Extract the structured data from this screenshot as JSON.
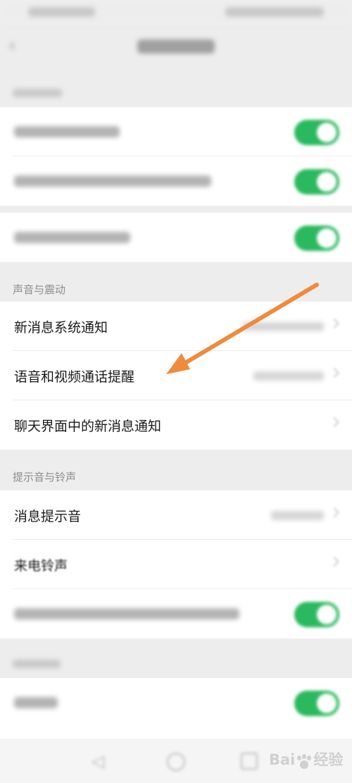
{
  "header": {
    "back_icon": "chevron-left-icon",
    "title_text": ""
  },
  "sections": {
    "sound_vibration": {
      "title": "声音与震动",
      "items": [
        {
          "label": "新消息系统通知",
          "value": ""
        },
        {
          "label": "语音和视频通话提醒",
          "value": ""
        },
        {
          "label": "聊天界面中的新消息通知",
          "value": ""
        }
      ]
    },
    "tones_ringtones": {
      "title": "提示音与铃声",
      "items": [
        {
          "label": "消息提示音",
          "value": ""
        },
        {
          "label": "来电铃声",
          "value": ""
        }
      ]
    }
  },
  "toggle_states": {
    "row1": true,
    "row2": true,
    "row3": true,
    "tones_row3": true,
    "last_row": true
  },
  "colors": {
    "accent_green": "#2ab95e",
    "arrow_orange": "#f08a3c",
    "background": "#ededed"
  },
  "watermark": {
    "brand_left": "Bai",
    "brand_right": "经验"
  }
}
